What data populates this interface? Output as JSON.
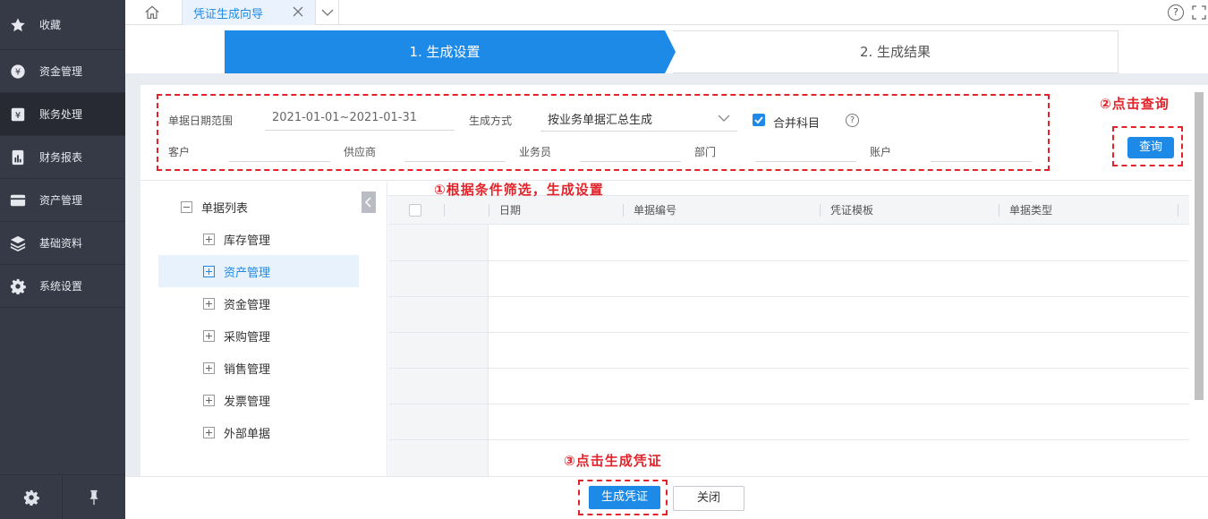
{
  "sidebar": {
    "items": [
      {
        "label": "收藏",
        "icon": "star-icon"
      },
      {
        "label": "资金管理",
        "icon": "fund-icon"
      },
      {
        "label": "账务处理",
        "icon": "ledger-icon"
      },
      {
        "label": "财务报表",
        "icon": "report-icon"
      },
      {
        "label": "资产管理",
        "icon": "asset-icon"
      },
      {
        "label": "基础资料",
        "icon": "layers-icon"
      },
      {
        "label": "系统设置",
        "icon": "gear-icon"
      }
    ],
    "active_index": 2
  },
  "tabs": {
    "active_label": "凭证生成向导"
  },
  "steps": {
    "step1": "1. 生成设置",
    "step2": "2. 生成结果"
  },
  "filter": {
    "date_range_label": "单据日期范围",
    "date_range_value": "2021-01-01~2021-01-31",
    "method_label": "生成方式",
    "method_value": "按业务单据汇总生成",
    "merge_label": "合并科目",
    "merge_checked": true,
    "customer_label": "客户",
    "supplier_label": "供应商",
    "salesperson_label": "业务员",
    "department_label": "部门",
    "account_label": "账户",
    "query_button": "查询"
  },
  "annotations": {
    "a1": "①根据条件筛选，生成设置",
    "a2": "②点击查询",
    "a3": "③点击生成凭证"
  },
  "tree": {
    "root": "单据列表",
    "items": [
      "库存管理",
      "资产管理",
      "资金管理",
      "采购管理",
      "销售管理",
      "发票管理",
      "外部单据"
    ],
    "selected_index": 1
  },
  "grid": {
    "columns": [
      "日期",
      "单据编号",
      "凭证模板",
      "单据类型"
    ]
  },
  "footer": {
    "generate_button": "生成凭证",
    "close_button": "关闭"
  },
  "colors": {
    "accent": "#1e8ae8",
    "annotation": "#e2242a",
    "sidebar": "#363a46"
  }
}
